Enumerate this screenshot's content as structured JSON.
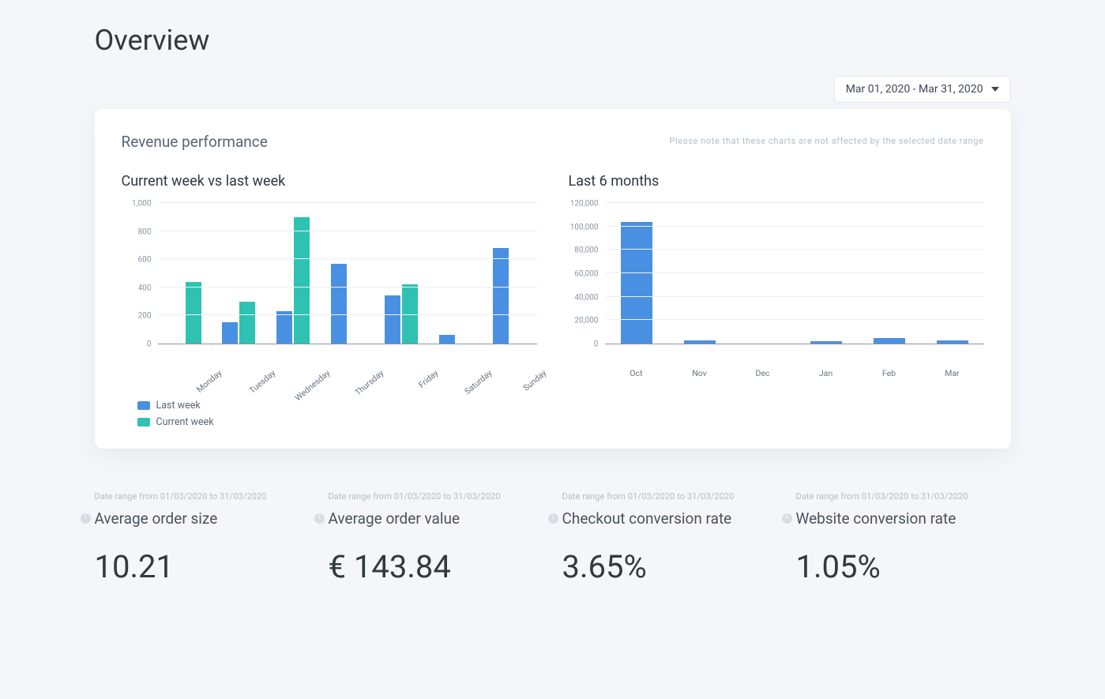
{
  "page_title": "Overview",
  "date_picker": {
    "label": "Mar 01, 2020 - Mar 31, 2020"
  },
  "revenue_card": {
    "title": "Revenue performance",
    "note": "Please note that these charts are not affected by the selected date range",
    "chart_week_title": "Current week vs last week",
    "chart_months_title": "Last 6 months",
    "legend": {
      "last": "Last week",
      "curr": "Current week"
    }
  },
  "metrics_range": "Date range from 01/03/2020 to 31/03/2020",
  "metrics": [
    {
      "label": "Average order size",
      "value": "10.21"
    },
    {
      "label": "Average order value",
      "value": "€ 143.84"
    },
    {
      "label": "Checkout conversion rate",
      "value": "3.65%"
    },
    {
      "label": "Website conversion rate",
      "value": "1.05%"
    }
  ],
  "chart_data": [
    {
      "type": "bar",
      "title": "Current week vs last week",
      "categories": [
        "Monday",
        "Tuesday",
        "Wednesday",
        "Thursday",
        "Friday",
        "Saturday",
        "Sunday"
      ],
      "series": [
        {
          "name": "Last week",
          "values": [
            0,
            150,
            230,
            570,
            340,
            60,
            680
          ]
        },
        {
          "name": "Current week",
          "values": [
            440,
            300,
            900,
            0,
            420,
            0,
            0
          ]
        }
      ],
      "xlabel": "",
      "ylabel": "",
      "ylim": [
        0,
        1000
      ],
      "y_ticks": [
        0,
        200,
        400,
        600,
        800,
        1000
      ],
      "legend_position": "bottom-left",
      "colors": {
        "Last week": "#4a90e2",
        "Current week": "#2fc2b2"
      }
    },
    {
      "type": "bar",
      "title": "Last 6 months",
      "categories": [
        "Oct",
        "Nov",
        "Dec",
        "Jan",
        "Feb",
        "Mar"
      ],
      "series": [
        {
          "name": "Revenue",
          "values": [
            104000,
            3000,
            0,
            2000,
            5000,
            3000
          ]
        }
      ],
      "xlabel": "",
      "ylabel": "",
      "ylim": [
        0,
        120000
      ],
      "y_ticks": [
        0,
        20000,
        40000,
        60000,
        80000,
        100000,
        120000
      ],
      "colors": {
        "Revenue": "#4a90e2"
      }
    }
  ]
}
